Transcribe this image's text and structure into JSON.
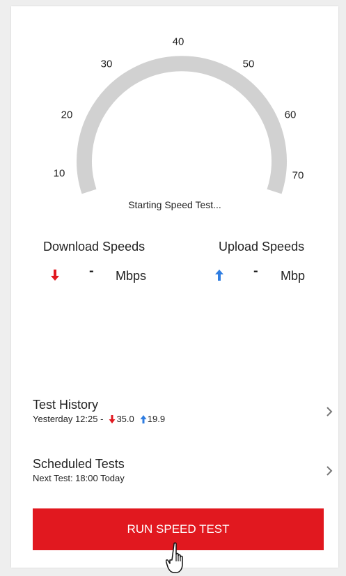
{
  "gauge": {
    "ticks": [
      "10",
      "20",
      "30",
      "40",
      "50",
      "60",
      "70"
    ],
    "status": "Starting Speed Test..."
  },
  "download": {
    "title": "Download Speeds",
    "value": "-",
    "unit": "Mbps",
    "arrow_color": "#e1181f"
  },
  "upload": {
    "title": "Upload Speeds",
    "value": "-",
    "unit": "Mbp",
    "arrow_color": "#2f7de1"
  },
  "history": {
    "title": "Test History",
    "sub_prefix": "Yesterday 12:25 -",
    "download": "35.0",
    "upload": "19.9"
  },
  "scheduled": {
    "title": "Scheduled Tests",
    "sub": "Next Test: 18:00 Today"
  },
  "run_button": {
    "label": "RUN SPEED TEST",
    "color": "#e1181f"
  },
  "icons": [
    "down-arrow-icon",
    "up-arrow-icon",
    "chevron-right-icon",
    "hand-cursor-icon"
  ]
}
